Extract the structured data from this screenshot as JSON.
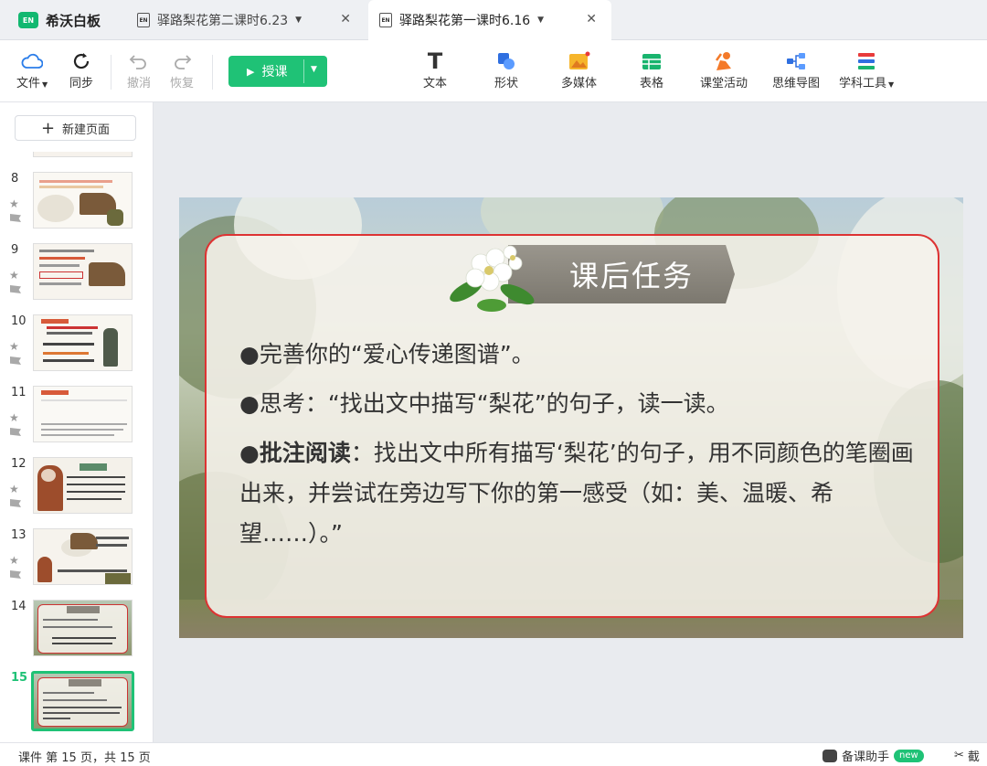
{
  "app": {
    "logo": "EN",
    "name": "希沃白板"
  },
  "tabs": [
    {
      "label": "驿路梨花第二课时6.23",
      "icon": "EN",
      "active": false
    },
    {
      "label": "驿路梨花第一课时6.16",
      "icon": "EN",
      "active": true
    }
  ],
  "toolbar": {
    "file": "文件",
    "sync": "同步",
    "undo": "撤消",
    "redo": "恢复",
    "teach": "授课",
    "text": "文本",
    "shape": "形状",
    "media": "多媒体",
    "table": "表格",
    "activity": "课堂活动",
    "mindmap": "思维导图",
    "subject_tools": "学科工具"
  },
  "sidebar": {
    "new_page": "新建页面",
    "slides": [
      {
        "num": "8"
      },
      {
        "num": "9"
      },
      {
        "num": "10"
      },
      {
        "num": "11"
      },
      {
        "num": "12"
      },
      {
        "num": "13"
      },
      {
        "num": "14"
      },
      {
        "num": "15"
      }
    ]
  },
  "slide": {
    "title": "课后任务",
    "bullet1": "●完善你的“爱心传递图谱”。",
    "bullet2": "●思考：“找出文中描写“梨花”的句子，读一读。",
    "bullet3_bold": "●批注阅读",
    "bullet3_rest": "：找出文中所有描写‘梨花’的句子，用不同颜色的笔圈画出来，并尝试在旁边写下你的第一感受（如：美、温暖、希望……）。”"
  },
  "status": {
    "text": "课件 第 15 页，共 15 页",
    "assistant": "备课助手",
    "badge": "new",
    "screenshot": "截"
  },
  "colors": {
    "accent": "#1fc276",
    "card_border": "#d33333"
  }
}
